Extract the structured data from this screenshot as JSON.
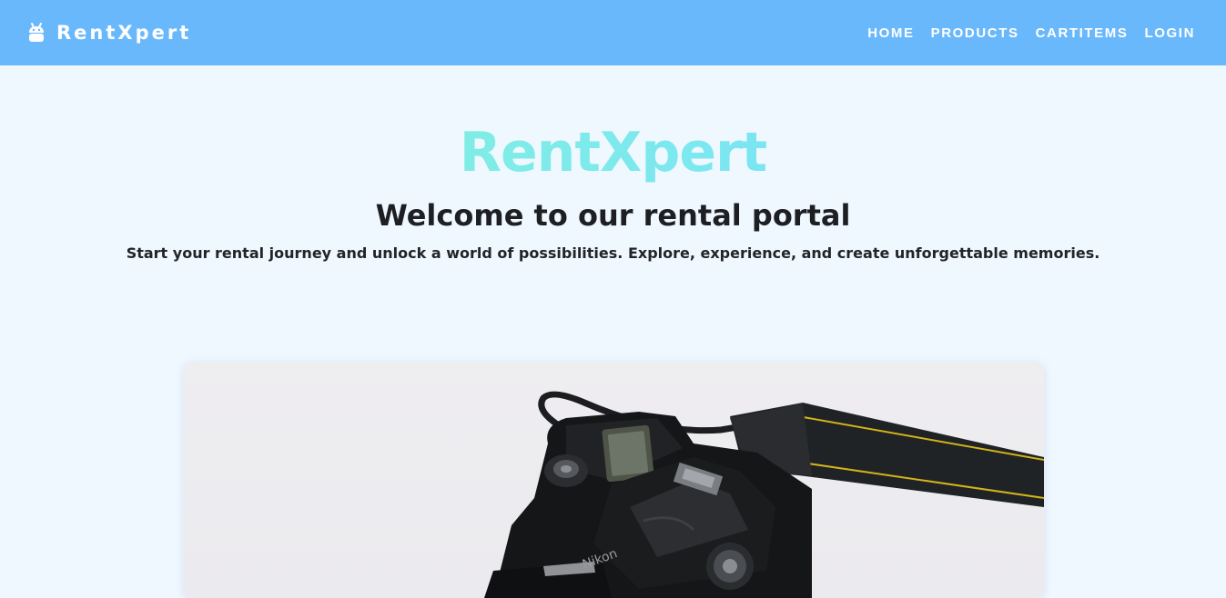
{
  "navbar": {
    "brand": "RentXpert",
    "brand_icon": "android-icon",
    "links": [
      "HOME",
      "PRODUCTS",
      "CARTITEMS",
      "LOGIN"
    ],
    "background": "#6ab8fc"
  },
  "hero": {
    "title": "RentXpert",
    "heading": "Welcome to our rental portal",
    "subtitle": "Start your rental journey and unlock a world of possibilities. Explore, experience, and create unforgettable memories."
  },
  "colors": {
    "page_bg": "#eff7ff",
    "title_gradient_start": "#86f7cf",
    "title_gradient_end": "#6fd8ff"
  }
}
